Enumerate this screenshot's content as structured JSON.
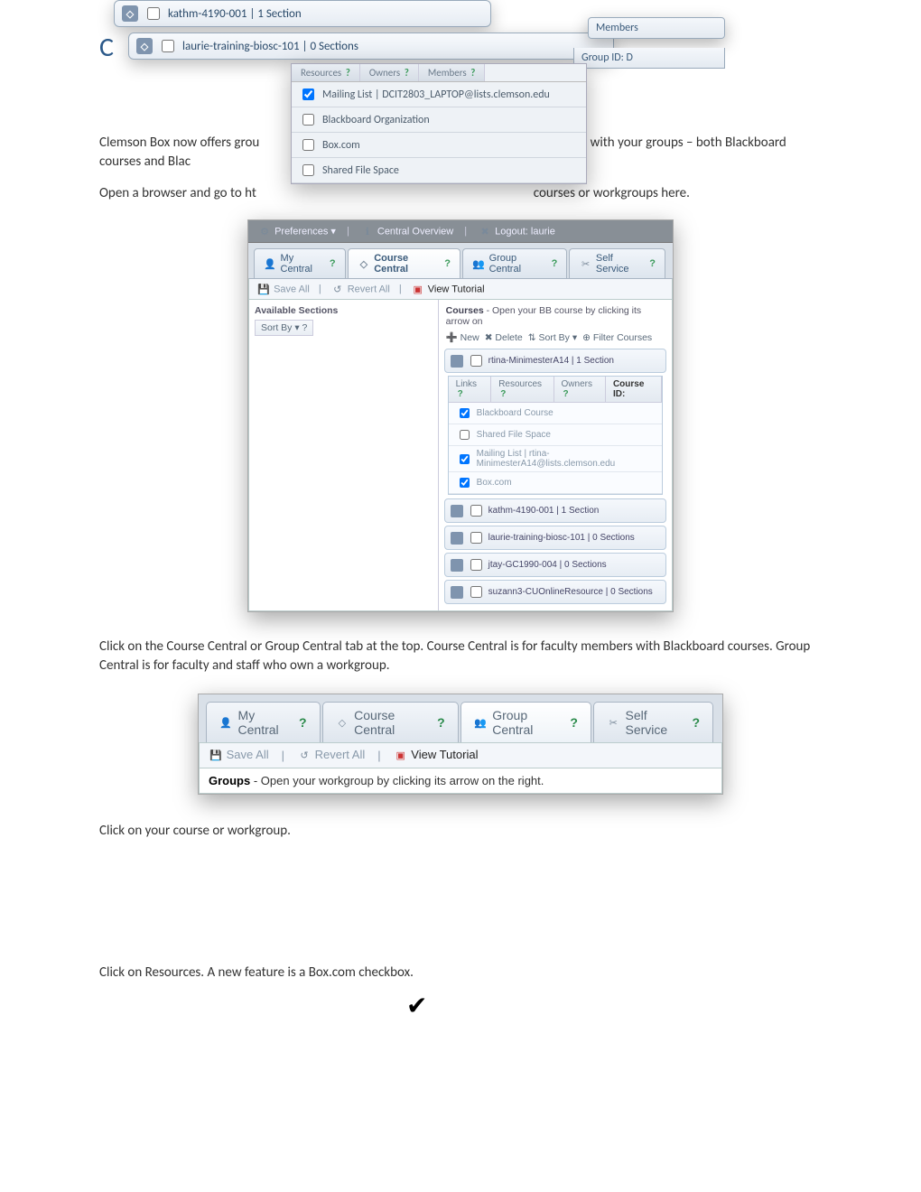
{
  "heading_partial": "C",
  "intro_paragraph_1_left": "Clemson Box now offers grou",
  "intro_paragraph_1_right": "ler with your groups – both Blackboard courses and Blac",
  "intro_paragraph_2_left": "Open a browser and go to ht",
  "intro_paragraph_2_right": "courses or workgroups here.",
  "mid_paragraph": "Click on the Course Central or Group Central tab at the top. Course Central is for faculty members with Blackboard courses.  Group Central is for faculty and staff who own a workgroup.",
  "post_tabs_paragraph": "Click on your course or workgroup.",
  "resources_paragraph": "Click on Resources.  A new feature is a Box.com checkbox.",
  "figTop": {
    "row1": "kathm-4190-001  |  1 Section",
    "row2": "laurie-training-biosc-101  |  0 Sections",
    "popout_members": "Members",
    "popout_group_id": "Group ID: D",
    "res_tabs": {
      "a": "Resources",
      "b": "Owners",
      "c": "Members",
      "help": "?"
    },
    "res_items": {
      "mailing": "Mailing List  |  DCIT2803_LAPTOP@lists.clemson.edu",
      "bb_org": "Blackboard Organization",
      "box": "Box.com",
      "sfs": "Shared File Space"
    }
  },
  "figCentral": {
    "toolbar": {
      "prefs": "Preferences",
      "overview": "Central Overview",
      "logout": "Logout: laurie"
    },
    "tabs": {
      "my": "My Central",
      "course": "Course Central",
      "group": "Group Central",
      "self": "Self Service"
    },
    "subbar": {
      "save": "Save All",
      "revert": "Revert All",
      "tutorial": "View Tutorial"
    },
    "left_title": "Available Sections",
    "sortby": "Sort By ▾  ?",
    "courses_head_label": "Courses",
    "courses_head_text": " - Open your BB course by clicking its arrow on",
    "toolbar2": {
      "new": "New",
      "delete": "Delete",
      "sort": "Sort By ▾",
      "filter": "Filter Courses"
    },
    "course_open": "rtina-MinimesterA14  |  1 Section",
    "expand_tabs": {
      "links": "Links",
      "resources": "Resources",
      "owners": "Owners",
      "courseid": "Course ID:"
    },
    "expand_items": {
      "bb": "Blackboard Course",
      "sfs": "Shared File Space",
      "mailing": "Mailing List  |  rtina-MinimesterA14@lists.clemson.edu",
      "box": "Box.com"
    },
    "rows": {
      "r1": "kathm-4190-001  |  1 Section",
      "r2": "laurie-training-biosc-101  |  0 Sections",
      "r3": "jtay-GC1990-004  |  0 Sections",
      "r4": "suzann3-CUOnlineResource  |  0 Sections"
    }
  },
  "figTabs2": {
    "tabs": {
      "my": "My Central",
      "course": "Course Central",
      "group": "Group Central",
      "self": "Self Service"
    },
    "subbar": {
      "save": "Save All",
      "revert": "Revert All",
      "tutorial": "View Tutorial"
    },
    "info_label": "Groups",
    "info_text": " - Open your workgroup by clicking its arrow on the right."
  }
}
